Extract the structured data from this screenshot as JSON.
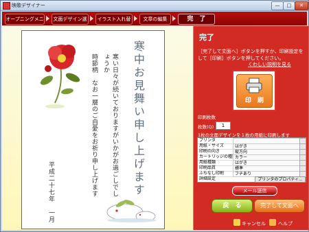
{
  "window": {
    "title": "映歌デザイナー",
    "minimize_glyph": "—",
    "maximize_glyph": "□",
    "close_glyph": "✕"
  },
  "steps": [
    {
      "label": "オープニングメニュー"
    },
    {
      "label": "文面デザイン選択"
    },
    {
      "label": "イラスト入れ替え"
    },
    {
      "label": "文章の編集"
    },
    {
      "label": "完　了"
    }
  ],
  "card": {
    "title": "寒中お見舞い申し上げます",
    "body1": "寒い日々が続いておりますがいかがお過ごしでしょうか",
    "body2": "時節柄　なお一層のご自愛をお祈り申し上げます",
    "date": "平成二十七年　一月"
  },
  "panel": {
    "title": "完了",
    "desc": "［完了して文面へ］ボタンを押すか、印刷設定をして［印刷］ボタンを押してください。",
    "link": "くわしい説明を見る",
    "print_label": "印　刷",
    "print_settings_head": "印刷枚数",
    "copies_label": "枚数(Q)",
    "copies_value": "1",
    "note": "1枚の文面デザインを１枚の用紙に印刷します",
    "settings": [
      {
        "key": "プリンタ",
        "value": ""
      },
      {
        "key": "用紙・サイズ",
        "value": "はがき"
      },
      {
        "key": "印刷の向き",
        "value": "縦方向"
      },
      {
        "key": "カートリッジの種類",
        "value": "カラー"
      },
      {
        "key": "用紙種類",
        "value": "はがき"
      },
      {
        "key": "印刷品質",
        "value": "標準"
      },
      {
        "key": "ふちなし印刷",
        "value": "フチあり"
      }
    ],
    "detail_label": "詳細設定",
    "properties_label": "プリンタのプロパティ...",
    "mail_label": "メール送信",
    "back_label": "戻　る",
    "done_label": "完了して文面へ",
    "cancel_label": "キャンセル",
    "help_label": "ヘルプ"
  },
  "colors": {
    "accent": "#d12b23",
    "header": "#a30808",
    "preview_bg": "#fdf9cc"
  }
}
